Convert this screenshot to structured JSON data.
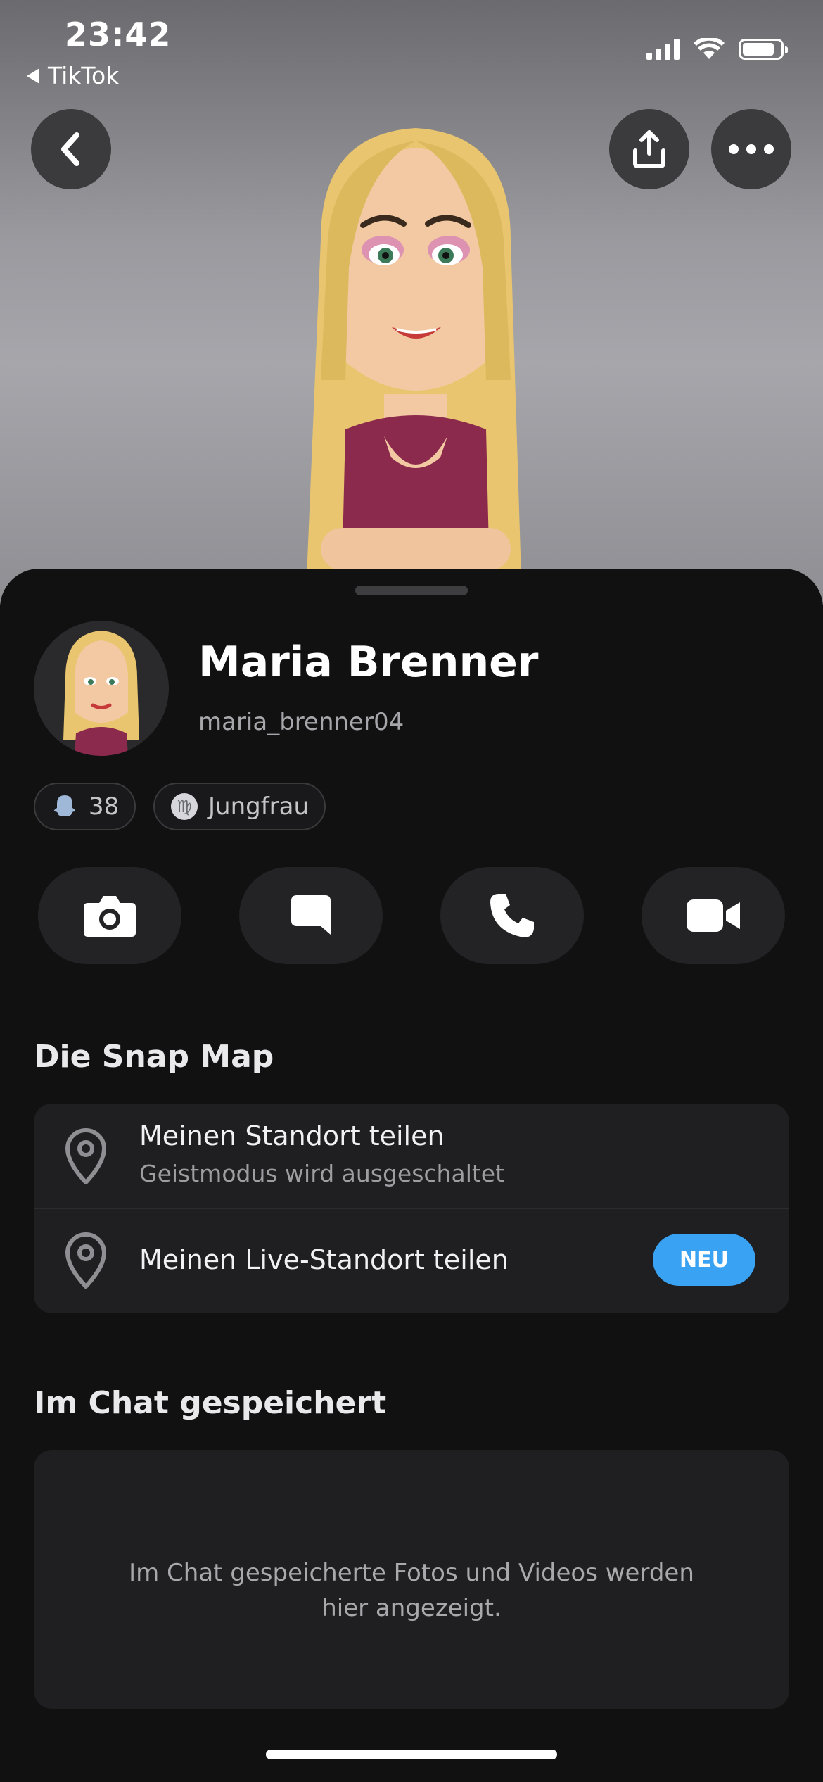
{
  "status_bar": {
    "time": "23:42",
    "back_app": "TikTok"
  },
  "header": {
    "back_icon": "chevron-left-icon",
    "share_icon": "share-upload-icon",
    "more_icon": "more-dots-icon"
  },
  "profile": {
    "name": "Maria Brenner",
    "username": "maria_brenner04",
    "snapscore": "38",
    "zodiac": "Jungfrau"
  },
  "actions": [
    {
      "icon": "camera-icon"
    },
    {
      "icon": "chat-icon"
    },
    {
      "icon": "phone-icon"
    },
    {
      "icon": "video-camera-icon"
    }
  ],
  "snap_map": {
    "title": "Die Snap Map",
    "rows": [
      {
        "title": "Meinen Standort teilen",
        "subtitle": "Geistmodus wird ausgeschaltet"
      },
      {
        "title": "Meinen Live-Standort teilen",
        "badge": "NEU"
      }
    ]
  },
  "saved": {
    "title": "Im Chat gespeichert",
    "empty_text": "Im Chat gespeicherte Fotos und Videos werden hier angezeigt."
  },
  "colors": {
    "badge_blue": "#3aa2f2",
    "sheet_bg": "#111112",
    "card_bg": "#1f1f21"
  }
}
